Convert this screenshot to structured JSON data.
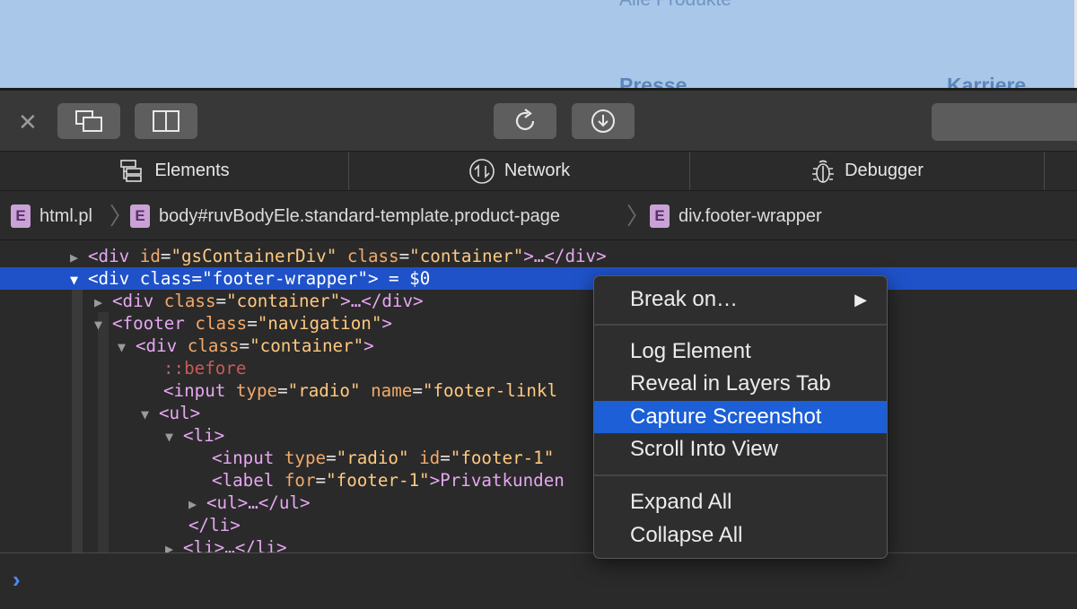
{
  "webpage": {
    "faded_link": "Alle Produkte",
    "footer_heading_1": "Presse",
    "footer_heading_2": "Karriere"
  },
  "toolbar": {
    "close_icon": "close-icon",
    "buttons": [
      "dock-window-icon",
      "dock-side-icon",
      "reload-icon",
      "download-icon"
    ]
  },
  "tabs": [
    {
      "label": "Elements",
      "icon": "elements-icon"
    },
    {
      "label": "Network",
      "icon": "network-icon"
    },
    {
      "label": "Debugger",
      "icon": "debugger-icon"
    }
  ],
  "breadcrumb": [
    {
      "badge": "E",
      "label": "html.pl"
    },
    {
      "badge": "E",
      "label": "body#ruvBodyEle.standard-template.product-page"
    },
    {
      "badge": "E",
      "label": "div.footer-wrapper"
    }
  ],
  "dom": {
    "row1": {
      "open": "<div ",
      "a1": "id",
      "v1": "\"gsContainerDiv\"",
      "a2": "class",
      "v2": "\"container\"",
      "rest": ">…</div>"
    },
    "row2": {
      "open": "<div ",
      "a1": "class",
      "v1": "\"footer-wrapper\"",
      "rest": "> = $0"
    },
    "row3": {
      "open": "<div ",
      "a1": "class",
      "v1": "\"container\"",
      "rest": ">…</div>"
    },
    "row4": {
      "open": "<footer ",
      "a1": "class",
      "v1": "\"navigation\"",
      "rest": ">"
    },
    "row5": {
      "open": "<div ",
      "a1": "class",
      "v1": "\"container\"",
      "rest": ">"
    },
    "row6": {
      "pseudo": "::before"
    },
    "row7": {
      "open": "<input ",
      "a1": "type",
      "v1": "\"radio\"",
      "a2": "name",
      "v2": "\"footer-linkl"
    },
    "row8": {
      "open": "<ul>"
    },
    "row9": {
      "open": "<li>"
    },
    "row10": {
      "open": "<input ",
      "a1": "type",
      "v1": "\"radio\"",
      "a2": "id",
      "v2": "\"footer-1\""
    },
    "row11": {
      "open": "<label ",
      "a1": "for",
      "v1": "\"footer-1\"",
      "rest": ">Privatkunden"
    },
    "row12": {
      "open": "<ul>…</ul>"
    },
    "row13": {
      "open": "</li>"
    },
    "row14": {
      "open": "<li>…</li>"
    }
  },
  "context_menu": {
    "items": [
      {
        "label": "Break on…",
        "submenu": true
      },
      {
        "label": "Log Element"
      },
      {
        "label": "Reveal in Layers Tab"
      },
      {
        "label": "Capture Screenshot",
        "highlighted": true
      },
      {
        "label": "Scroll Into View"
      },
      {
        "label": "Expand All"
      },
      {
        "label": "Collapse All"
      }
    ],
    "submenu_arrow": "▶"
  },
  "console": {
    "prompt": "›"
  },
  "colors": {
    "selection": "#1f52c9",
    "menu_highlight": "#1c5fd6",
    "tag": "#e6a7f2",
    "attr_name": "#f3a96a",
    "attr_value": "#ffc980"
  }
}
